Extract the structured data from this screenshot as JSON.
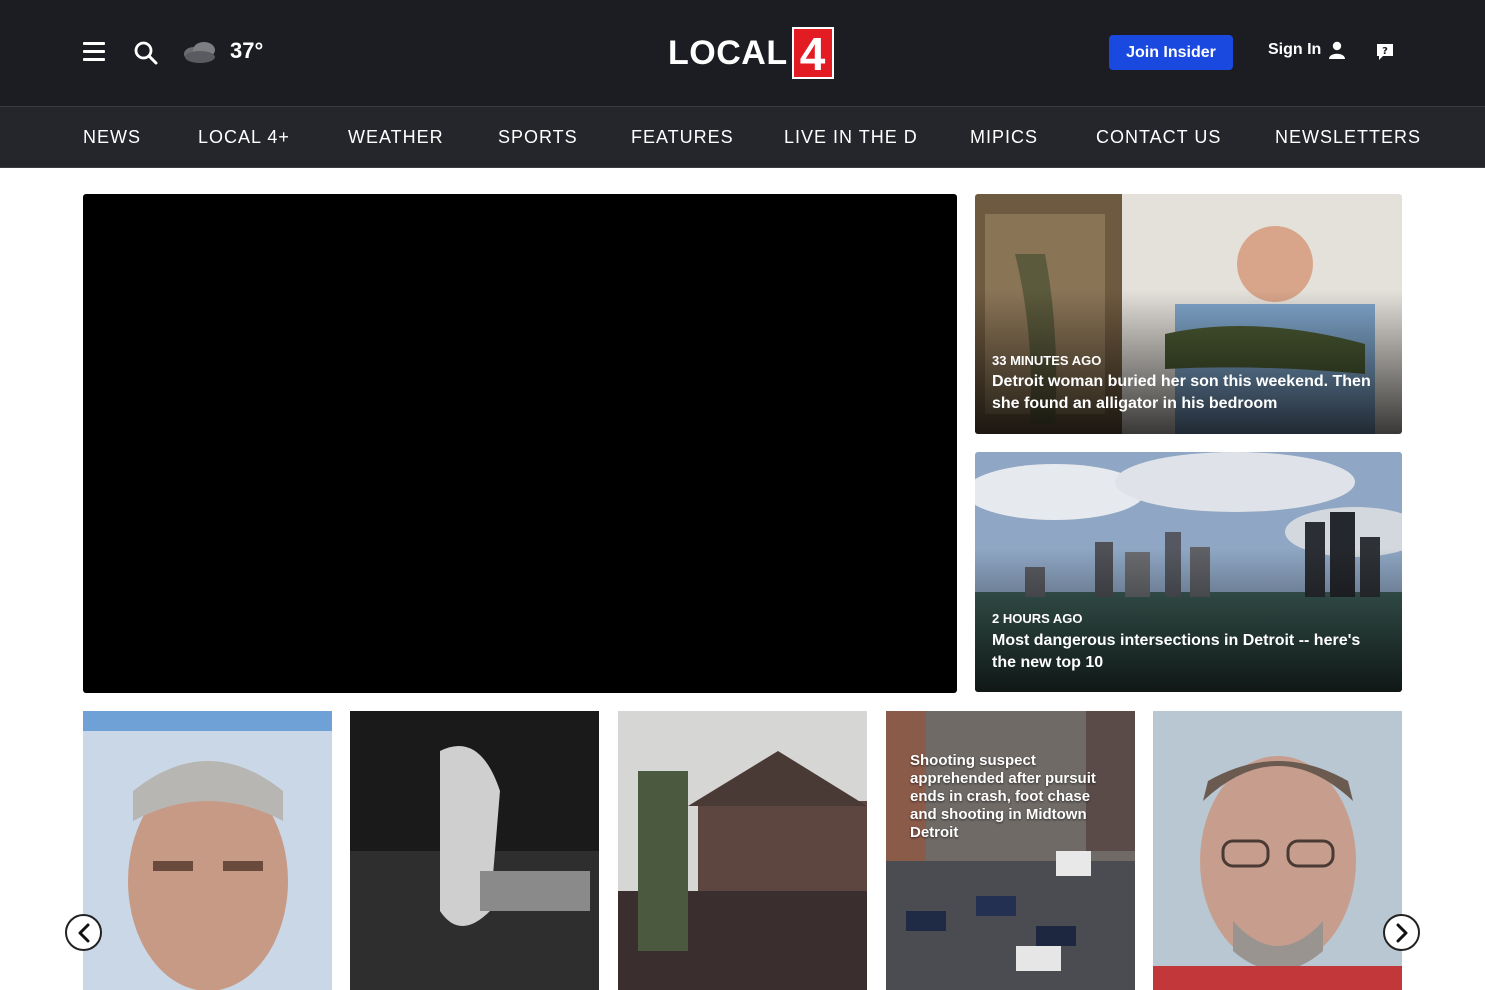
{
  "header": {
    "temperature": "37°",
    "weather_icon": "cloudy-icon",
    "logo_text": "LOCAL",
    "logo_number": "4",
    "join_label": "Join Insider",
    "signin_label": "Sign In",
    "colors": {
      "bg": "#1c1d22",
      "join": "#1a49e0",
      "logo_red": "#e31b23"
    }
  },
  "nav": {
    "items": [
      "NEWS",
      "LOCAL 4+",
      "WEATHER",
      "SPORTS",
      "FEATURES",
      "LIVE IN THE D",
      "MIPICS",
      "CONTACT US",
      "NEWSLETTERS"
    ]
  },
  "side_stories": [
    {
      "time": "33 MINUTES AGO",
      "headline": "Detroit woman buried her son this weekend. Then she found an alligator in his bedroom"
    },
    {
      "time": "2 HOURS AGO",
      "headline": "Most dangerous intersections in Detroit -- here's the new top 10"
    }
  ],
  "carousel": {
    "cards": [
      {
        "overlay_text": ""
      },
      {
        "overlay_text": ""
      },
      {
        "overlay_text": ""
      },
      {
        "overlay_text": "Shooting suspect apprehended after pursuit ends in crash, foot chase and shooting in Midtown Detroit"
      },
      {
        "overlay_text": ""
      }
    ],
    "prev_icon": "chevron-left-icon",
    "next_icon": "chevron-right-icon"
  }
}
